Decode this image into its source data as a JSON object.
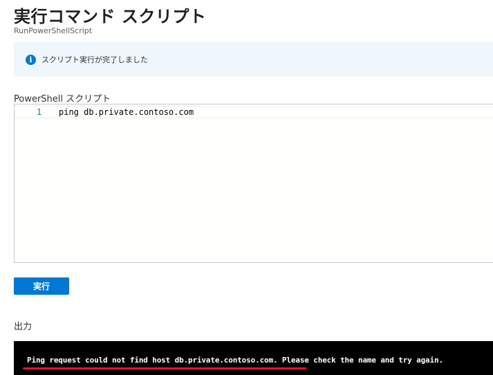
{
  "page": {
    "title": "実行コマンド スクリプト",
    "subtitle": "RunPowerShellScript"
  },
  "banner": {
    "icon": "info-icon",
    "icon_glyph": "i",
    "message": "スクリプト実行が完了しました",
    "accent_color": "#0078d4"
  },
  "editor": {
    "label": "PowerShell スクリプト",
    "lines": [
      {
        "number": "1",
        "code": "ping db.private.contoso.com"
      }
    ]
  },
  "actions": {
    "run_label": "実行",
    "run_color": "#0078d4"
  },
  "output": {
    "label": "出力",
    "text": "Ping request could not find host db.private.contoso.com. Please check the name and try again.",
    "annotation_color": "#e81123"
  }
}
